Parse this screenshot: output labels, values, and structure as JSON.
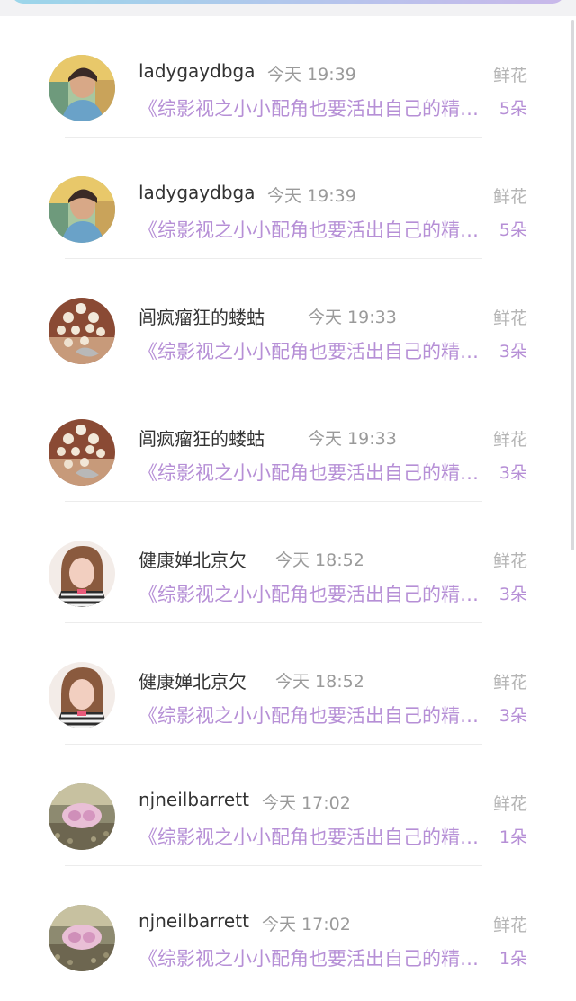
{
  "gift_list": {
    "items": [
      {
        "username": "ladygaydbga",
        "time": "今天 19:39",
        "gift_label": "鲜花",
        "book_title": "《综影视之小小配角也要活出自己的精彩》",
        "gift_count": "5朵",
        "avatar_icon": "portrait-young-man-avatar-icon"
      },
      {
        "username": "ladygaydbga",
        "time": "今天 19:39",
        "gift_label": "鲜花",
        "book_title": "《综影视之小小配角也要活出自己的精彩》",
        "gift_count": "5朵",
        "avatar_icon": "portrait-young-man-avatar-icon"
      },
      {
        "username": "闾疯瘤狂的蝼蛄",
        "time": "今天 19:33",
        "gift_label": "鲜花",
        "book_title": "《综影视之小小配角也要活出自己的精彩》",
        "gift_count": "3朵",
        "avatar_icon": "pearl-brooch-avatar-icon"
      },
      {
        "username": "闾疯瘤狂的蝼蛄",
        "time": "今天 19:33",
        "gift_label": "鲜花",
        "book_title": "《综影视之小小配角也要活出自己的精彩》",
        "gift_count": "3朵",
        "avatar_icon": "pearl-brooch-avatar-icon"
      },
      {
        "username": "健康婵北京欠",
        "time": "今天 18:52",
        "gift_label": "鲜花",
        "book_title": "《综影视之小小配角也要活出自己的精彩》",
        "gift_count": "3朵",
        "avatar_icon": "portrait-woman-avatar-icon"
      },
      {
        "username": "健康婵北京欠",
        "time": "今天 18:52",
        "gift_label": "鲜花",
        "book_title": "《综影视之小小配角也要活出自己的精彩》",
        "gift_count": "3朵",
        "avatar_icon": "portrait-woman-avatar-icon"
      },
      {
        "username": "njneilbarrett",
        "time": "今天 17:02",
        "gift_label": "鲜花",
        "book_title": "《综影视之小小配角也要活出自己的精彩》",
        "gift_count": "1朵",
        "avatar_icon": "pink-shell-avatar-icon"
      },
      {
        "username": "njneilbarrett",
        "time": "今天 17:02",
        "gift_label": "鲜花",
        "book_title": "《综影视之小小配角也要活出自己的精彩》",
        "gift_count": "1朵",
        "avatar_icon": "pink-shell-avatar-icon"
      }
    ]
  }
}
